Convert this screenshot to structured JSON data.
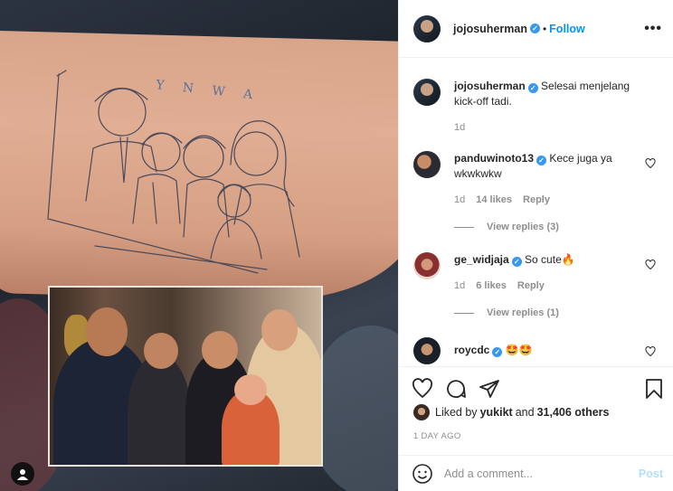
{
  "post": {
    "author": "jojosuherman",
    "dot": "•",
    "follow_label": "Follow",
    "more_label": "•••",
    "tattoo_text": "Y N W A"
  },
  "caption": {
    "username": "jojosuherman",
    "text": "Selesai menjelang kick-off tadi.",
    "time": "1d"
  },
  "comments": [
    {
      "username": "panduwinoto13",
      "text": "Kece juga ya wkwkwkw",
      "time": "1d",
      "likes": "14 likes",
      "reply_label": "Reply",
      "view_replies": "View replies (3)"
    },
    {
      "username": "ge_widjaja",
      "text": "So cute🔥",
      "time": "1d",
      "likes": "6 likes",
      "reply_label": "Reply",
      "view_replies": "View replies (1)"
    },
    {
      "username": "roycdc",
      "text": "🤩🤩"
    }
  ],
  "likes_bar": {
    "prefix": "Liked by ",
    "user": "yukikt",
    "middle": " and ",
    "count": "31,406 others"
  },
  "timestamp": "1 DAY AGO",
  "add_comment": {
    "placeholder": "Add a comment...",
    "post_label": "Post"
  },
  "colors": {
    "link": "#0095f6",
    "verified": "#3897f0",
    "muted": "#8e8e8e",
    "post_disabled": "#b2dffc"
  },
  "icons": [
    "heart-icon",
    "comment-icon",
    "share-icon",
    "bookmark-icon",
    "emoji-icon",
    "more-icon",
    "verified-icon",
    "user-tag-icon"
  ]
}
